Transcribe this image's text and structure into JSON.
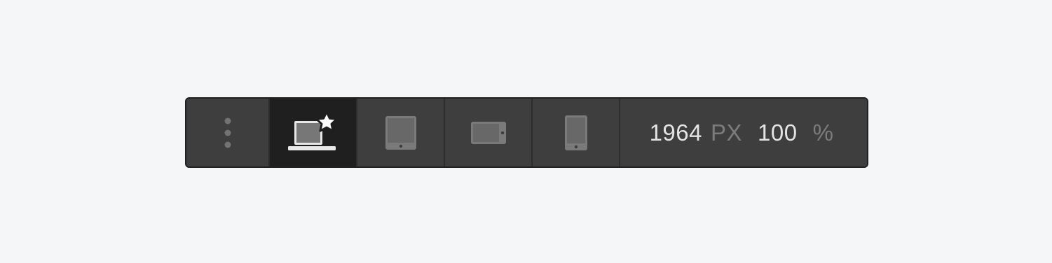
{
  "toolbar": {
    "more_button": {
      "icon": "more-vertical-icon"
    },
    "breakpoints": [
      {
        "name": "desktop",
        "icon": "laptop-star-icon",
        "active": true
      },
      {
        "name": "tablet",
        "icon": "tablet-icon",
        "active": false
      },
      {
        "name": "mobile-landscape",
        "icon": "phone-landscape-icon",
        "active": false
      },
      {
        "name": "mobile-portrait",
        "icon": "phone-portrait-icon",
        "active": false
      }
    ],
    "width_value": "1964",
    "width_unit": "PX",
    "zoom_value": "100",
    "zoom_unit": "%"
  },
  "colors": {
    "page_background": "#f5f6f8",
    "toolbar_background": "#3e3e3e",
    "active_cell_background": "#1f1f1f",
    "icon_fill": "#7a7a7a",
    "value_text": "#e4e4e4",
    "unit_text": "#7c7c7c"
  }
}
